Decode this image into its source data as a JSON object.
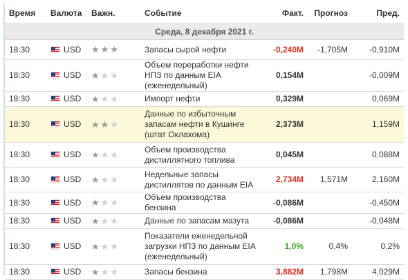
{
  "header": {
    "time": "Время",
    "currency": "Валюта",
    "importance": "Важн.",
    "event": "Событие",
    "actual": "Факт.",
    "forecast": "Прогноз",
    "previous": "Пред."
  },
  "day_label": "Среда, 8 декабря 2021 г.",
  "rows": [
    {
      "time": "18:30",
      "currency": "USD",
      "importance": 3,
      "event": "Запасы сырой нефти",
      "actual": "-0,240M",
      "actual_color": "red",
      "forecast": "-1,705M",
      "previous": "-0,910M",
      "highlight": false
    },
    {
      "time": "18:30",
      "currency": "USD",
      "importance": 1,
      "event": "Объем переработки нефти НПЗ по данным EIA (еженедельный)",
      "actual": "0,154M",
      "actual_color": "black",
      "forecast": "",
      "previous": "-0,009M",
      "highlight": false
    },
    {
      "time": "18:30",
      "currency": "USD",
      "importance": 1,
      "event": "Импорт нефти",
      "actual": "0,329M",
      "actual_color": "black",
      "forecast": "",
      "previous": "0,069M",
      "highlight": false
    },
    {
      "time": "18:30",
      "currency": "USD",
      "importance": 2,
      "event": "Данные по избыточным запасам нефти в Кушинге (штат Оклахома)",
      "actual": "2,373M",
      "actual_color": "black",
      "forecast": "",
      "previous": "1,159M",
      "highlight": true
    },
    {
      "time": "18:30",
      "currency": "USD",
      "importance": 1,
      "event": "Объем производства дистиллятного топлива",
      "actual": "0,045M",
      "actual_color": "black",
      "forecast": "",
      "previous": "0,088M",
      "highlight": false
    },
    {
      "time": "18:30",
      "currency": "USD",
      "importance": 1,
      "event": "Недельные запасы дистиллятов по данным EIA",
      "actual": "2,734M",
      "actual_color": "red",
      "forecast": "1,571M",
      "previous": "2,160M",
      "highlight": false
    },
    {
      "time": "18:30",
      "currency": "USD",
      "importance": 1,
      "event": "Объем производства бензина",
      "actual": "-0,086M",
      "actual_color": "black",
      "forecast": "",
      "previous": "-0,450M",
      "highlight": false
    },
    {
      "time": "18:30",
      "currency": "USD",
      "importance": 1,
      "event": "Данные по запасам мазута",
      "actual": "-0,086M",
      "actual_color": "black",
      "forecast": "",
      "previous": "-0,048M",
      "highlight": false
    },
    {
      "time": "18:30",
      "currency": "USD",
      "importance": 1,
      "event": "Показатели еженедельной загрузки НПЗ по данным EIA (еженедельный)",
      "actual": "1,0%",
      "actual_color": "green",
      "forecast": "0,4%",
      "previous": "0,2%",
      "highlight": false
    },
    {
      "time": "18:30",
      "currency": "USD",
      "importance": 1,
      "event": "Запасы бензина",
      "actual": "3,882M",
      "actual_color": "red",
      "forecast": "1,798M",
      "previous": "4,029M",
      "highlight": false
    }
  ],
  "colors": {
    "negative": "#e52b1f",
    "positive": "#2aa80f",
    "highlight_row": "#fbf9d9",
    "day_row": "#eaeaea"
  },
  "icons": {
    "flag": "us-flag-icon",
    "star": "star-icon"
  }
}
